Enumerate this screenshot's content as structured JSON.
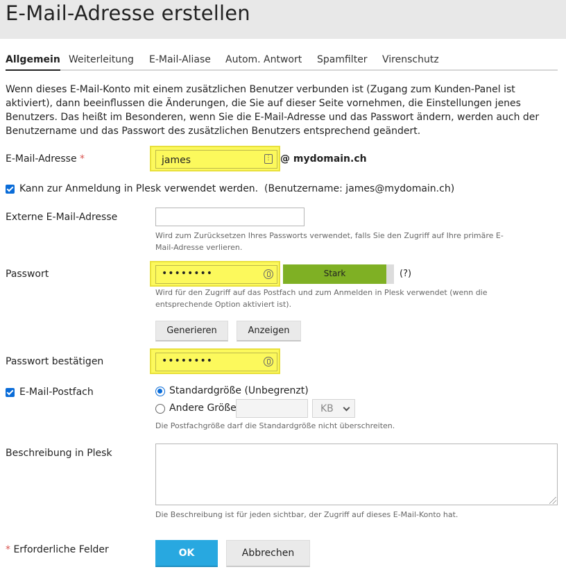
{
  "page": {
    "title": "E-Mail-Adresse erstellen"
  },
  "tabs": [
    {
      "label": "Allgemein",
      "active": true
    },
    {
      "label": "Weiterleitung",
      "active": false
    },
    {
      "label": "E-Mail-Aliase",
      "active": false
    },
    {
      "label": "Autom. Antwort",
      "active": false
    },
    {
      "label": "Spamfilter",
      "active": false
    },
    {
      "label": "Virenschutz",
      "active": false
    }
  ],
  "intro": "Wenn dieses E-Mail-Konto mit einem zusätzlichen Benutzer verbunden ist (Zugang zum Kunden-Panel ist aktiviert), dann beeinflussen die Änderungen, die Sie auf dieser Seite vornehmen, die Einstellungen jenes Benutzers. Das heißt im Besonderen, wenn Sie die E-Mail-Adresse und das Passwort ändern, werden auch der Benutzername und das Passwort des zusätzlichen Benutzers entsprechend geändert.",
  "email": {
    "label": "E-Mail-Adresse",
    "required_mark": "*",
    "value": "james",
    "domain": "@ mydomain.ch"
  },
  "login": {
    "checked": true,
    "label": "Kann zur Anmeldung in Plesk verwendet werden.",
    "username_note": "(Benutzername: james@mydomain.ch)"
  },
  "external": {
    "label": "Externe E-Mail-Adresse",
    "value": "",
    "hint": "Wird zum Zurücksetzen Ihres Passworts verwendet, falls Sie den Zugriff auf Ihre primäre E-Mail-Adresse verlieren."
  },
  "password": {
    "label": "Passwort",
    "masked": "••••••••",
    "strength_label": "Stark",
    "strength_fraction": 0.93,
    "help": "(?)",
    "hint": "Wird für den Zugriff auf das Postfach und zum Anmelden in Plesk verwendet (wenn die entsprechende Option aktiviert ist).",
    "generate_label": "Generieren",
    "show_label": "Anzeigen"
  },
  "confirm": {
    "label": "Passwort bestätigen",
    "masked": "••••••••"
  },
  "mailbox": {
    "checked": true,
    "label": "E-Mail-Postfach",
    "option_default": "Standardgröße (Unbegrenzt)",
    "option_other": "Andere Größe",
    "selected": "default",
    "size_value": "",
    "unit": "KB",
    "hint": "Die Postfachgröße darf die Standardgröße nicht überschreiten."
  },
  "description": {
    "label": "Beschreibung in Plesk",
    "value": "",
    "hint": "Die Beschreibung ist für jeden sichtbar, der Zugriff auf dieses E-Mail-Konto hat."
  },
  "footer": {
    "required_mark": "*",
    "required_note": "Erforderliche Felder",
    "ok_label": "OK",
    "cancel_label": "Abbrechen"
  },
  "colors": {
    "highlight": "#fcf95c",
    "strength": "#7fb024",
    "primary": "#28a8e0",
    "checkbox": "#0a6cd8",
    "required": "#d9534f"
  }
}
